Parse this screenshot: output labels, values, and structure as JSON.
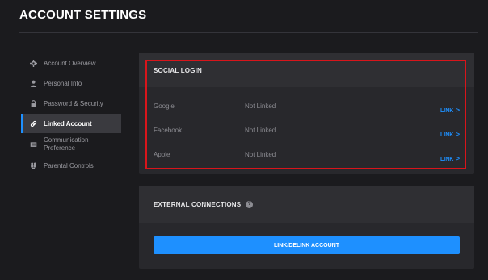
{
  "page": {
    "title": "ACCOUNT SETTINGS"
  },
  "sidebar": {
    "items": [
      {
        "label": "Account Overview",
        "icon": "gear-icon"
      },
      {
        "label": "Personal Info",
        "icon": "person-icon"
      },
      {
        "label": "Password & Security",
        "icon": "lock-icon"
      },
      {
        "label": "Linked Account",
        "icon": "link-icon",
        "active": true
      },
      {
        "label_line1": "Communication",
        "label_line2": "Preference",
        "icon": "message-icon"
      },
      {
        "label": "Parental Controls",
        "icon": "family-icon"
      }
    ]
  },
  "social_login": {
    "title": "SOCIAL LOGIN",
    "rows": [
      {
        "provider": "Google",
        "status": "Not Linked",
        "action": "LINK"
      },
      {
        "provider": "Facebook",
        "status": "Not Linked",
        "action": "LINK"
      },
      {
        "provider": "Apple",
        "status": "Not Linked",
        "action": "LINK"
      }
    ],
    "chevron": ">"
  },
  "external_connections": {
    "title": "EXTERNAL CONNECTIONS",
    "help_glyph": "?",
    "button_label": "LINK/DELINK ACCOUNT"
  },
  "colors": {
    "accent": "#1e90ff",
    "highlight_border": "#d8151b",
    "background": "#1b1b1e",
    "panel": "#28282c"
  }
}
